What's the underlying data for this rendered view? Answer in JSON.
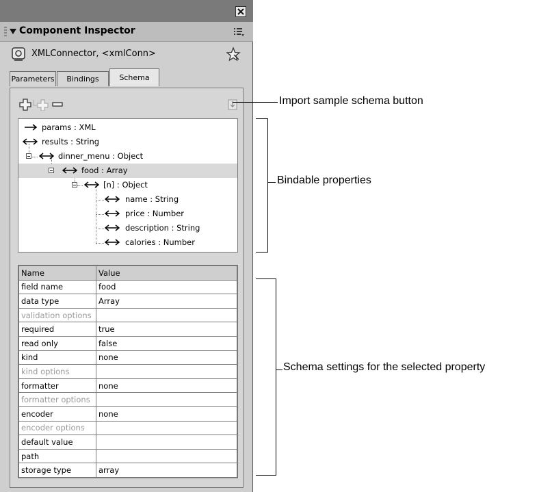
{
  "panel": {
    "title": "Component Inspector",
    "component_name": "XMLConnector, <xmlConn>"
  },
  "tabs": [
    {
      "label": "Parameters",
      "active": false
    },
    {
      "label": "Bindings",
      "active": false
    },
    {
      "label": "Schema",
      "active": true
    }
  ],
  "tree": [
    {
      "label": "params : XML",
      "arrow": "right"
    },
    {
      "label": "results : String",
      "arrow": "both"
    },
    {
      "label": "dinner_menu : Object",
      "arrow": "both"
    },
    {
      "label": "food : Array",
      "arrow": "both",
      "selected": true
    },
    {
      "label": "[n] : Object",
      "arrow": "both"
    },
    {
      "label": "name : String",
      "arrow": "both"
    },
    {
      "label": "price : Number",
      "arrow": "both"
    },
    {
      "label": "description : String",
      "arrow": "both"
    },
    {
      "label": "calories : Number",
      "arrow": "both"
    }
  ],
  "grid": {
    "columns": [
      "Name",
      "Value"
    ],
    "rows": [
      {
        "name": "field name",
        "value": "food"
      },
      {
        "name": "data type",
        "value": "Array"
      },
      {
        "name": "validation options",
        "value": "",
        "dim": true
      },
      {
        "name": "required",
        "value": "true"
      },
      {
        "name": "read only",
        "value": "false"
      },
      {
        "name": "kind",
        "value": "none"
      },
      {
        "name": "kind options",
        "value": "",
        "dim": true
      },
      {
        "name": "formatter",
        "value": "none"
      },
      {
        "name": "formatter options",
        "value": "",
        "dim": true
      },
      {
        "name": "encoder",
        "value": "none"
      },
      {
        "name": "encoder options",
        "value": "",
        "dim": true
      },
      {
        "name": "default value",
        "value": ""
      },
      {
        "name": "path",
        "value": ""
      },
      {
        "name": "storage type",
        "value": "array"
      }
    ]
  },
  "callouts": {
    "import": "Import sample schema button",
    "bindable": "Bindable properties",
    "settings": "Schema settings for the selected property"
  }
}
